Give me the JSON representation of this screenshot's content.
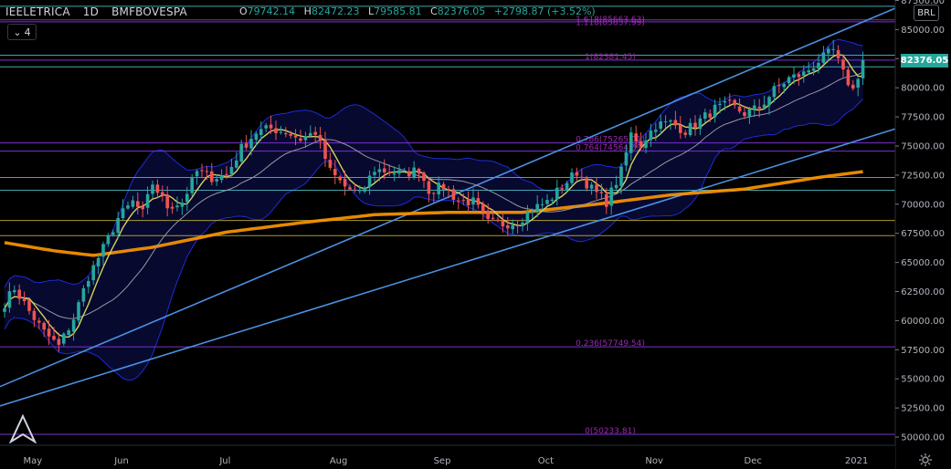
{
  "header": {
    "symbol": "IEELETRICA",
    "interval": "1D",
    "exchange": "BMFBOVESPA",
    "open_label": "O",
    "open": "79742.14",
    "high_label": "H",
    "high": "82472.23",
    "low_label": "L",
    "low": "79585.81",
    "close_label": "C",
    "close": "82376.05",
    "change": "+2798.87 (+3.52%)"
  },
  "indicators_toggle": {
    "count": "4"
  },
  "currency": "BRL",
  "last_price": "82376.05",
  "colors": {
    "up": "#26a69a",
    "down": "#ef5350",
    "fib": "#7e2fd0",
    "fib_label": "#9c27b0",
    "ema200": "#ff9800",
    "ma_fast": "#d7d25a",
    "bb_basis": "#9598a1",
    "bb_band": "#1e2bd6",
    "channel": "#4a90e2",
    "hline_cyan": "#4fc3c9",
    "hline_yellow": "#c9b637",
    "price_tag": "#26a69a"
  },
  "chart_data": {
    "type": "candlestick",
    "y_range": [
      49000,
      87500
    ],
    "y_ticks": [
      "87500.00",
      "85000.00",
      "82500.00",
      "80000.00",
      "77500.00",
      "75000.00",
      "72500.00",
      "70000.00",
      "67500.00",
      "65000.00",
      "62500.00",
      "60000.00",
      "57500.00",
      "55000.00",
      "52500.00",
      "50000.00"
    ],
    "y_tick_values": [
      87500,
      85000,
      82500,
      80000,
      77500,
      75000,
      72500,
      70000,
      67500,
      65000,
      62500,
      60000,
      57500,
      55000,
      52500,
      50000
    ],
    "x_labels": [
      {
        "label": "May",
        "t": 2
      },
      {
        "label": "Jun",
        "t": 20
      },
      {
        "label": "Jul",
        "t": 41
      },
      {
        "label": "Aug",
        "t": 64
      },
      {
        "label": "Sep",
        "t": 85
      },
      {
        "label": "Oct",
        "t": 106
      },
      {
        "label": "Nov",
        "t": 128
      },
      {
        "label": "Dec",
        "t": 148
      },
      {
        "label": "2021",
        "t": 169
      }
    ],
    "fib_levels": [
      {
        "label": "1.618(85663.63)",
        "value": 85664
      },
      {
        "label": "1.118(85837.99)",
        "value": 85838
      },
      {
        "label": "1(82381.45)",
        "value": 82381
      },
      {
        "label": "0.786(75265.01)",
        "value": 75265
      },
      {
        "label": "0.764(74564.39)",
        "value": 74564
      },
      {
        "label": "0.236(57749.54)",
        "value": 57750
      },
      {
        "label": "0(50233.81)",
        "value": 50234
      }
    ],
    "hlines": [
      {
        "value": 87000,
        "kind": "cyan"
      },
      {
        "value": 82800,
        "kind": "cyan"
      },
      {
        "value": 81800,
        "kind": "cyan"
      },
      {
        "value": 72300,
        "kind": "cyan"
      },
      {
        "value": 71200,
        "kind": "cyan"
      },
      {
        "value": 68600,
        "kind": "yellow"
      },
      {
        "value": 67300,
        "kind": "yellow"
      }
    ],
    "trendlines": [
      {
        "t1": 0,
        "v1": 54500,
        "t2": 177,
        "v2": 86200
      },
      {
        "t1": 0,
        "v1": 52800,
        "t2": 177,
        "v2": 76000
      }
    ],
    "close_anchors": [
      [
        0,
        61500
      ],
      [
        2,
        62800
      ],
      [
        5,
        60800
      ],
      [
        8,
        59000
      ],
      [
        11,
        57800
      ],
      [
        14,
        60200
      ],
      [
        17,
        63800
      ],
      [
        20,
        66200
      ],
      [
        23,
        68800
      ],
      [
        26,
        70200
      ],
      [
        28,
        69200
      ],
      [
        30,
        71800
      ],
      [
        33,
        69800
      ],
      [
        36,
        70200
      ],
      [
        39,
        72800
      ],
      [
        42,
        72300
      ],
      [
        45,
        72500
      ],
      [
        48,
        74800
      ],
      [
        51,
        76200
      ],
      [
        54,
        76500
      ],
      [
        57,
        76200
      ],
      [
        60,
        75600
      ],
      [
        63,
        76200
      ],
      [
        66,
        72800
      ],
      [
        69,
        71500
      ],
      [
        72,
        70800
      ],
      [
        75,
        73000
      ],
      [
        78,
        72800
      ],
      [
        81,
        72600
      ],
      [
        84,
        73000
      ],
      [
        86,
        71200
      ],
      [
        89,
        71500
      ],
      [
        92,
        70300
      ],
      [
        95,
        70200
      ],
      [
        98,
        68400
      ],
      [
        101,
        68300
      ],
      [
        104,
        68500
      ],
      [
        107,
        69600
      ],
      [
        110,
        70200
      ],
      [
        113,
        71500
      ],
      [
        116,
        72800
      ],
      [
        119,
        71300
      ],
      [
        122,
        70200
      ],
      [
        125,
        72800
      ],
      [
        127,
        76000
      ],
      [
        129,
        75200
      ],
      [
        132,
        76800
      ],
      [
        135,
        77000
      ],
      [
        138,
        76300
      ],
      [
        141,
        77200
      ],
      [
        144,
        78200
      ],
      [
        147,
        78500
      ],
      [
        150,
        77800
      ],
      [
        153,
        78300
      ],
      [
        156,
        79800
      ],
      [
        159,
        80800
      ],
      [
        162,
        81200
      ],
      [
        165,
        82300
      ],
      [
        168,
        83200
      ],
      [
        170,
        81200
      ],
      [
        172,
        79800
      ],
      [
        174,
        82376
      ]
    ],
    "ema200_anchors": [
      [
        0,
        66700
      ],
      [
        10,
        66000
      ],
      [
        18,
        65600
      ],
      [
        30,
        66300
      ],
      [
        45,
        67600
      ],
      [
        60,
        68400
      ],
      [
        75,
        69100
      ],
      [
        90,
        69300
      ],
      [
        105,
        69300
      ],
      [
        120,
        70000
      ],
      [
        135,
        70800
      ],
      [
        150,
        71300
      ],
      [
        165,
        72300
      ],
      [
        174,
        72800
      ]
    ]
  }
}
